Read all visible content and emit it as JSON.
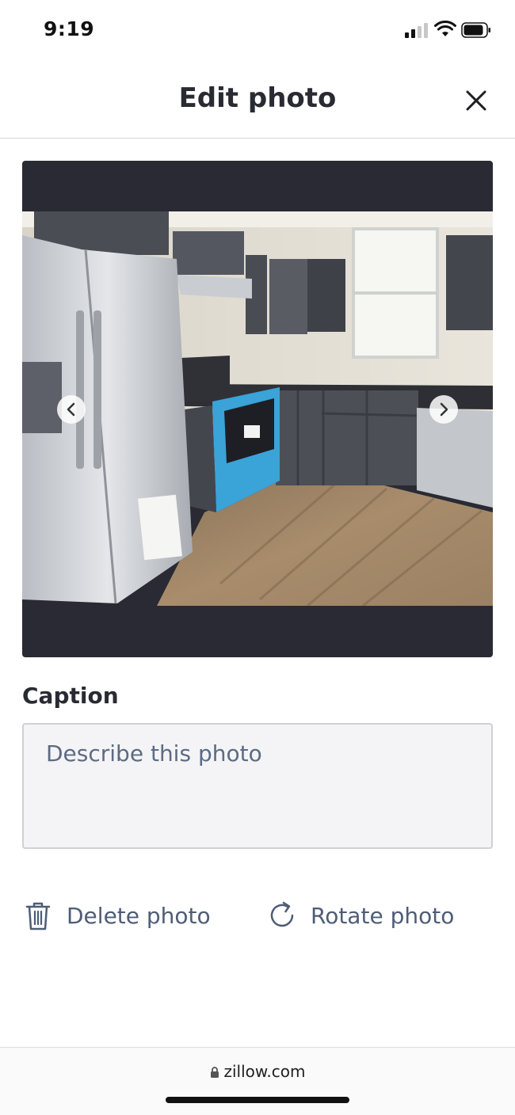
{
  "status_bar": {
    "time": "9:19"
  },
  "header": {
    "title": "Edit photo",
    "close_icon": "close-icon"
  },
  "photo_viewer": {
    "photo_alt": "kitchen-photo",
    "prev_icon": "chevron-left-icon",
    "next_icon": "chevron-right-icon"
  },
  "caption": {
    "label": "Caption",
    "placeholder": "Describe this photo",
    "value": ""
  },
  "actions": {
    "delete_label": "Delete photo",
    "delete_icon": "trash-icon",
    "rotate_label": "Rotate photo",
    "rotate_icon": "rotate-icon"
  },
  "browser": {
    "url": "zillow.com",
    "lock_icon": "lock-icon"
  },
  "colors": {
    "text_dark": "#2a2a33",
    "action_text": "#4e5d76",
    "photo_frame": "#292a33",
    "input_bg": "#f4f4f7",
    "input_border": "#d1d1d5"
  }
}
